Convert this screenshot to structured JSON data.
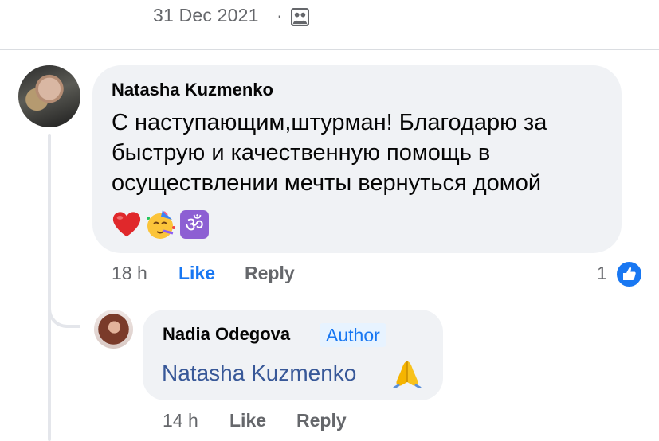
{
  "header": {
    "date": "31 Dec 2021",
    "separator": "·",
    "privacy_icon": "group-icon"
  },
  "comment": {
    "author": "Natasha Kuzmenko",
    "text": "С наступающим,штурман! Благодарю за быструю и качественную помощь в осуществлении мечты вернуться домой",
    "emojis": [
      "red-heart",
      "partying-face",
      "om-symbol"
    ],
    "time": "18 h",
    "like_label": "Like",
    "reply_label": "Reply",
    "reaction_count": "1",
    "reaction_icon": "like-icon"
  },
  "reply": {
    "author": "Nadia Odegova",
    "badge": "Author",
    "mention": "Natasha Kuzmenko",
    "emoji": "folded-hands",
    "time": "14 h",
    "like_label": "Like",
    "reply_label": "Reply"
  },
  "colors": {
    "bubble": "#f0f2f5",
    "link_blue": "#1877f2",
    "mention_blue": "#385898",
    "meta_gray": "#65676b"
  }
}
